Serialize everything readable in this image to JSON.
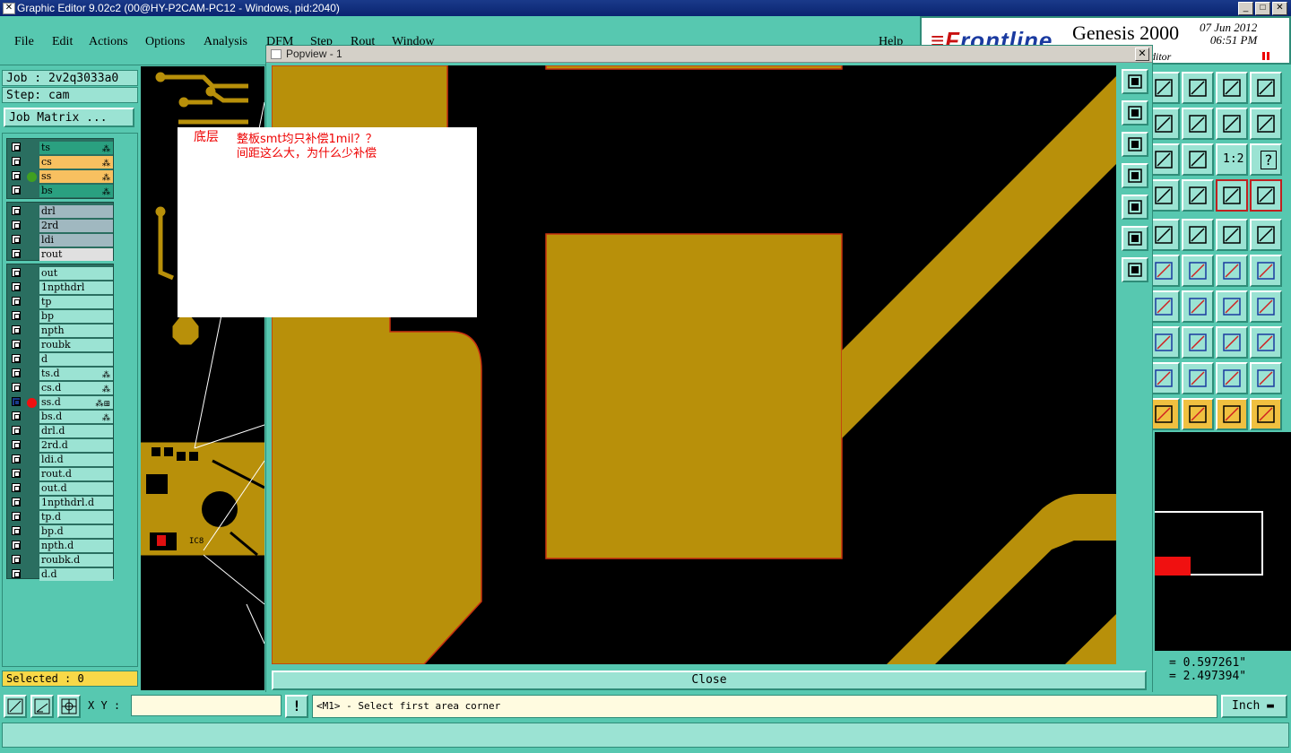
{
  "window": {
    "title": "Graphic Editor 9.02c2 (00@HY-P2CAM-PC12 - Windows, pid:2040)",
    "min": "_",
    "max": "□",
    "close": "✕"
  },
  "menu": {
    "items": [
      "File",
      "Edit",
      "Actions",
      "Options",
      "Analysis",
      "DFM",
      "Step",
      "Rout",
      "Window"
    ],
    "help": "Help"
  },
  "header": {
    "logo_a": "≡F",
    "logo_b": "rontline",
    "product": "Genesis 2000",
    "date": "07 Jun 2012",
    "time": "06:51 PM",
    "subtitle": "ditor"
  },
  "job": {
    "job_line": "Job : 2v2q3033a0",
    "step_line": "Step: cam",
    "matrix_button": "Job Matrix ..."
  },
  "layers": {
    "group1": [
      {
        "name": "ts",
        "bg": "#2aa080",
        "mark": "⁂"
      },
      {
        "name": "cs",
        "bg": "#f8c060",
        "mark": "⁂"
      },
      {
        "name": "ss",
        "bg": "#f8c060",
        "mark": "⁂",
        "dot": "#40a020"
      },
      {
        "name": "bs",
        "bg": "#2aa080",
        "mark": "⁂"
      }
    ],
    "group2": [
      {
        "name": "drl",
        "bg": "#a0b8c0"
      },
      {
        "name": "2rd",
        "bg": "#a0b8c0"
      },
      {
        "name": "ldi",
        "bg": "#a0b8c0"
      },
      {
        "name": "rout",
        "bg": "#e0e0e0"
      }
    ],
    "group3": [
      {
        "name": "out",
        "bg": "#9be3d3"
      },
      {
        "name": "1npthdrl",
        "bg": "#9be3d3"
      },
      {
        "name": "tp",
        "bg": "#9be3d3"
      },
      {
        "name": "bp",
        "bg": "#9be3d3"
      },
      {
        "name": "npth",
        "bg": "#9be3d3"
      },
      {
        "name": "roubk",
        "bg": "#9be3d3"
      },
      {
        "name": "d",
        "bg": "#9be3d3"
      },
      {
        "name": "ts.d",
        "bg": "#9be3d3",
        "mark": "⁂"
      },
      {
        "name": "cs.d",
        "bg": "#9be3d3",
        "mark": "⁂"
      },
      {
        "name": "ss.d",
        "bg": "#9be3d3",
        "mark": "⁂⊞",
        "dot": "#f01010",
        "active": true
      },
      {
        "name": "bs.d",
        "bg": "#9be3d3",
        "mark": "⁂"
      },
      {
        "name": "drl.d",
        "bg": "#9be3d3"
      },
      {
        "name": "2rd.d",
        "bg": "#9be3d3"
      },
      {
        "name": "ldi.d",
        "bg": "#9be3d3"
      },
      {
        "name": "rout.d",
        "bg": "#9be3d3"
      },
      {
        "name": "out.d",
        "bg": "#9be3d3"
      },
      {
        "name": "1npthdrl.d",
        "bg": "#9be3d3"
      },
      {
        "name": "tp.d",
        "bg": "#9be3d3"
      },
      {
        "name": "bp.d",
        "bg": "#9be3d3"
      },
      {
        "name": "npth.d",
        "bg": "#9be3d3"
      },
      {
        "name": "roubk.d",
        "bg": "#9be3d3"
      },
      {
        "name": "d.d",
        "bg": "#9be3d3"
      }
    ],
    "selected": "Selected : 0"
  },
  "popview": {
    "title": "Popview - 1",
    "close_x": "✕",
    "close_button": "Close",
    "copper_color": "#b8900a"
  },
  "annotation": {
    "tag": "底层",
    "text": "整板smt均只补偿1mil？？\n间距这么大，为什么少补偿"
  },
  "coords": {
    "x": "= 0.597261\"",
    "y": "= 2.497394\""
  },
  "bottom": {
    "xy_label": "X Y :",
    "xy_value": "",
    "excl": "!",
    "prompt": "<M1> - Select first area corner",
    "unit": "Inch"
  },
  "rtools": {
    "labels": [
      "1:2",
      "?"
    ]
  }
}
